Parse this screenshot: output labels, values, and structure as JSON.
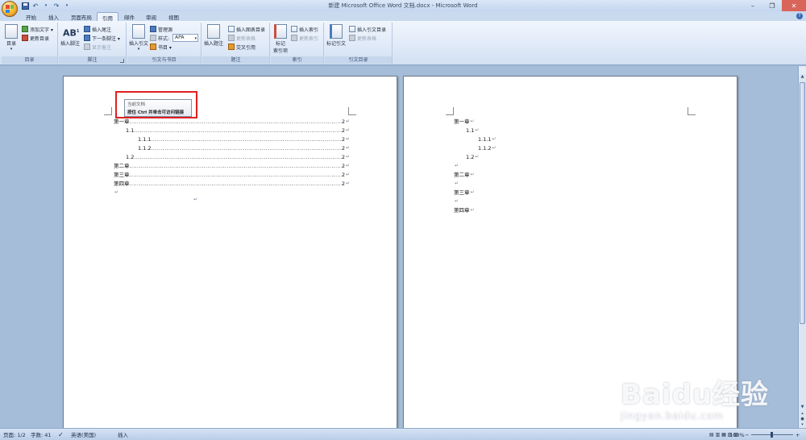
{
  "window": {
    "title": "新建 Microsoft Office Word 文档.docx - Microsoft Word"
  },
  "qat": {
    "save": "save-icon",
    "undo": "↶",
    "redo": "↷"
  },
  "tabs": [
    {
      "label": "开始"
    },
    {
      "label": "插入"
    },
    {
      "label": "页面布局"
    },
    {
      "label": "引用"
    },
    {
      "label": "邮件"
    },
    {
      "label": "审阅"
    },
    {
      "label": "视图"
    }
  ],
  "active_tab": "引用",
  "ribbon": {
    "toc": {
      "big": "目录",
      "add_text": "添加文字 ▾",
      "update": "更新目录",
      "label": "目录"
    },
    "footnote": {
      "big": "插入脚注",
      "insert_endnote": "插入尾注",
      "next_footnote": "下一条脚注 ▾",
      "show_notes": "显示备注",
      "label": "脚注"
    },
    "citation": {
      "big": "插入引文",
      "manage_sources": "管理源",
      "style_label": "样式:",
      "style_value": "APA",
      "bibliography": "书目 ▾",
      "label": "引文与书目"
    },
    "captions": {
      "big": "插入题注",
      "insert_table_of_figures": "插入图表目录",
      "update_table": "更新表格",
      "cross_ref": "交叉引用",
      "label": "题注"
    },
    "index": {
      "big_line1": "标记",
      "big_line2": "索引项",
      "insert_index": "插入索引",
      "update_index": "更新索引",
      "label": "索引"
    },
    "toa": {
      "big": "标记引文",
      "insert_toa": "插入引文目录",
      "update_table": "更新表格",
      "label": "引文目录"
    }
  },
  "tooltip": {
    "line1": "当前文档",
    "line2": "按住 Ctrl 并单击可访问链接"
  },
  "page1": {
    "toc": [
      {
        "text": "第一章",
        "page": "2"
      },
      {
        "text": "1.1",
        "page": "2"
      },
      {
        "text": "1.1.1",
        "page": "2"
      },
      {
        "text": "1.1.2",
        "page": "2"
      },
      {
        "text": "1.2",
        "page": "2"
      },
      {
        "text": "第二章",
        "page": "2"
      },
      {
        "text": "第三章",
        "page": "2"
      },
      {
        "text": "第四章",
        "page": "2"
      }
    ]
  },
  "page2": {
    "lines": [
      "第一章",
      "1.1",
      "1.1.1",
      "1.1.2",
      "1.2",
      "",
      "第二章",
      "",
      "第三章",
      "",
      "第四章"
    ]
  },
  "status": {
    "page": "页面: 1/2",
    "words": "字数: 41",
    "language": "英语(美国)",
    "mode": "插入",
    "zoom": "100%"
  },
  "watermark": {
    "main": "Baidu经验",
    "sub": "jingyan.baidu.com"
  }
}
